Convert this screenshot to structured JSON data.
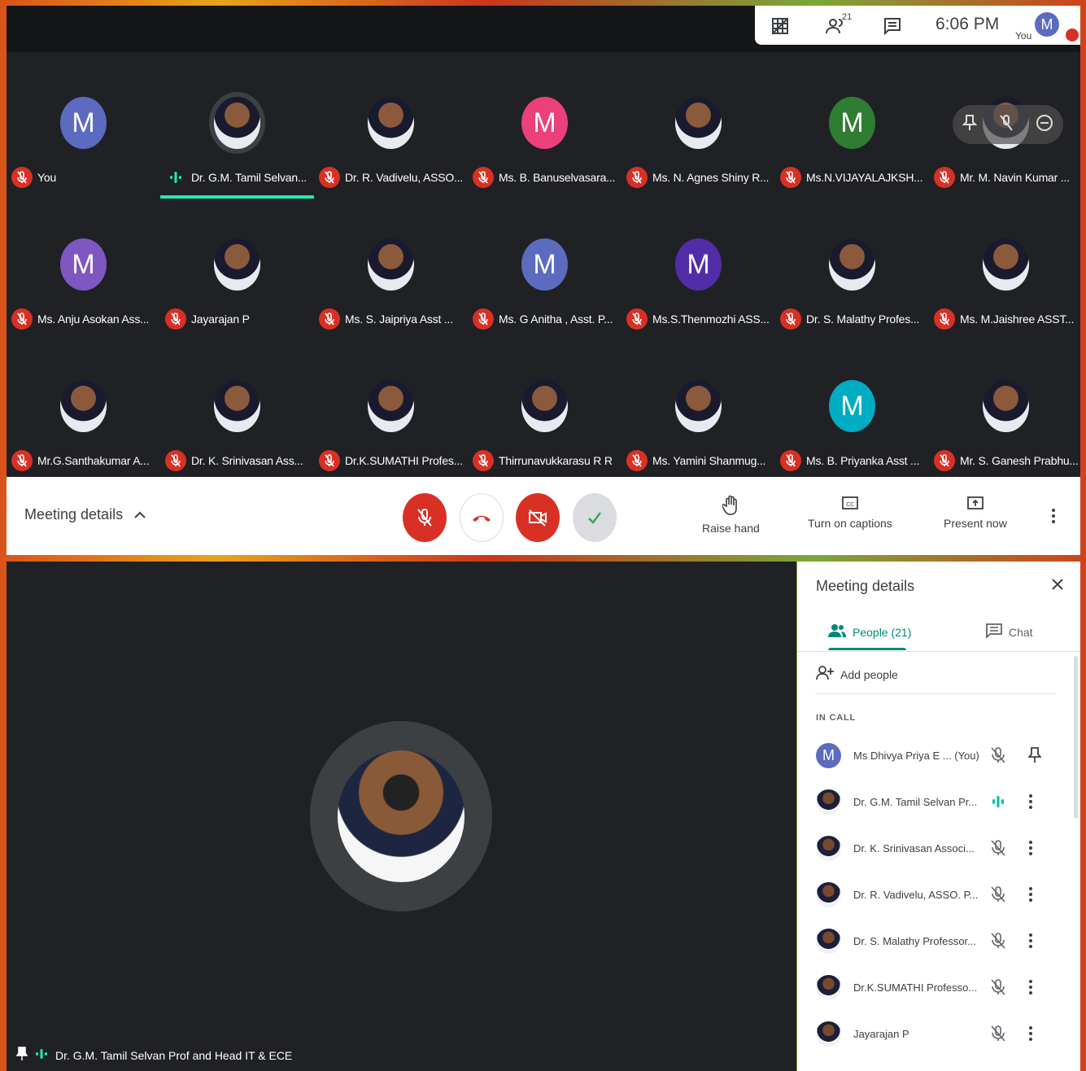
{
  "topbar": {
    "time": "6:06 PM",
    "people_count": "21",
    "you_label": "You",
    "you_initial": "M"
  },
  "participants": [
    {
      "name": "You",
      "initial": "M",
      "color": "#5c6bc0",
      "photo": false,
      "muted": true
    },
    {
      "name": "Dr. G.M. Tamil Selvan...",
      "initial": "",
      "color": "",
      "photo": true,
      "muted": false,
      "speaking": true
    },
    {
      "name": "Dr. R. Vadivelu, ASSO...",
      "initial": "",
      "color": "",
      "photo": true,
      "muted": true
    },
    {
      "name": "Ms. B. Banuselvasara...",
      "initial": "M",
      "color": "#ec407a",
      "photo": false,
      "muted": true
    },
    {
      "name": "Ms. N. Agnes Shiny R...",
      "initial": "",
      "color": "",
      "photo": true,
      "muted": true
    },
    {
      "name": "Ms.N.VIJAYALAJKSH...",
      "initial": "M",
      "color": "#2e7d32",
      "photo": false,
      "muted": true
    },
    {
      "name": "Mr. M. Navin Kumar ...",
      "initial": "",
      "color": "",
      "photo": true,
      "muted": true
    },
    {
      "name": "Ms. Anju Asokan Ass...",
      "initial": "M",
      "color": "#7e57c2",
      "photo": false,
      "muted": true
    },
    {
      "name": "Jayarajan P",
      "initial": "",
      "color": "",
      "photo": true,
      "muted": true
    },
    {
      "name": "Ms. S. Jaipriya Asst ...",
      "initial": "",
      "color": "",
      "photo": true,
      "muted": true
    },
    {
      "name": "Ms. G Anitha , Asst. P...",
      "initial": "M",
      "color": "#5c6bc0",
      "photo": false,
      "muted": true
    },
    {
      "name": "Ms.S.Thenmozhi ASS...",
      "initial": "M",
      "color": "#512da8",
      "photo": false,
      "muted": true
    },
    {
      "name": "Dr. S. Malathy Profes...",
      "initial": "",
      "color": "",
      "photo": true,
      "muted": true
    },
    {
      "name": "Ms. M.Jaishree ASST...",
      "initial": "",
      "color": "",
      "photo": true,
      "muted": true
    },
    {
      "name": "Mr.G.Santhakumar A...",
      "initial": "",
      "color": "",
      "photo": true,
      "muted": true
    },
    {
      "name": "Dr. K. Srinivasan Ass...",
      "initial": "",
      "color": "",
      "photo": true,
      "muted": true
    },
    {
      "name": "Dr.K.SUMATHI Profes...",
      "initial": "",
      "color": "",
      "photo": true,
      "muted": true
    },
    {
      "name": "Thirrunavukkarasu R R",
      "initial": "",
      "color": "",
      "photo": true,
      "muted": true
    },
    {
      "name": "Ms. Yamini Shanmug...",
      "initial": "",
      "color": "",
      "photo": true,
      "muted": true
    },
    {
      "name": "Ms. B. Priyanka Asst ...",
      "initial": "M",
      "color": "#00acc1",
      "photo": false,
      "muted": true
    },
    {
      "name": "Mr. S. Ganesh Prabhu...",
      "initial": "",
      "color": "",
      "photo": true,
      "muted": true
    }
  ],
  "controls": {
    "meeting_details": "Meeting details",
    "raise_hand": "Raise hand",
    "captions": "Turn on captions",
    "present": "Present now"
  },
  "main_stage": {
    "pinned_name": "Dr. G.M. Tamil Selvan Prof and Head IT & ECE"
  },
  "side_panel": {
    "title": "Meeting details",
    "tab_people": "People (21)",
    "tab_chat": "Chat",
    "add_people": "Add people",
    "in_call": "IN CALL",
    "people": [
      {
        "name": "Ms Dhivya Priya E ... (You)",
        "initial": "M",
        "state": "muted",
        "action": "pin"
      },
      {
        "name": "Dr. G.M. Tamil Selvan Pr...",
        "initial": "",
        "state": "speaking",
        "action": "menu"
      },
      {
        "name": "Dr. K. Srinivasan Associ...",
        "initial": "",
        "state": "muted",
        "action": "menu"
      },
      {
        "name": "Dr. R. Vadivelu, ASSO. P...",
        "initial": "",
        "state": "muted",
        "action": "menu"
      },
      {
        "name": "Dr. S. Malathy Professor...",
        "initial": "",
        "state": "muted",
        "action": "menu"
      },
      {
        "name": "Dr.K.SUMATHI Professo...",
        "initial": "",
        "state": "muted",
        "action": "menu"
      },
      {
        "name": "Jayarajan P",
        "initial": "",
        "state": "muted",
        "action": "menu"
      }
    ]
  },
  "colors": {
    "accent": "#00897b",
    "danger": "#d93025",
    "speaking": "#1de9b6"
  }
}
